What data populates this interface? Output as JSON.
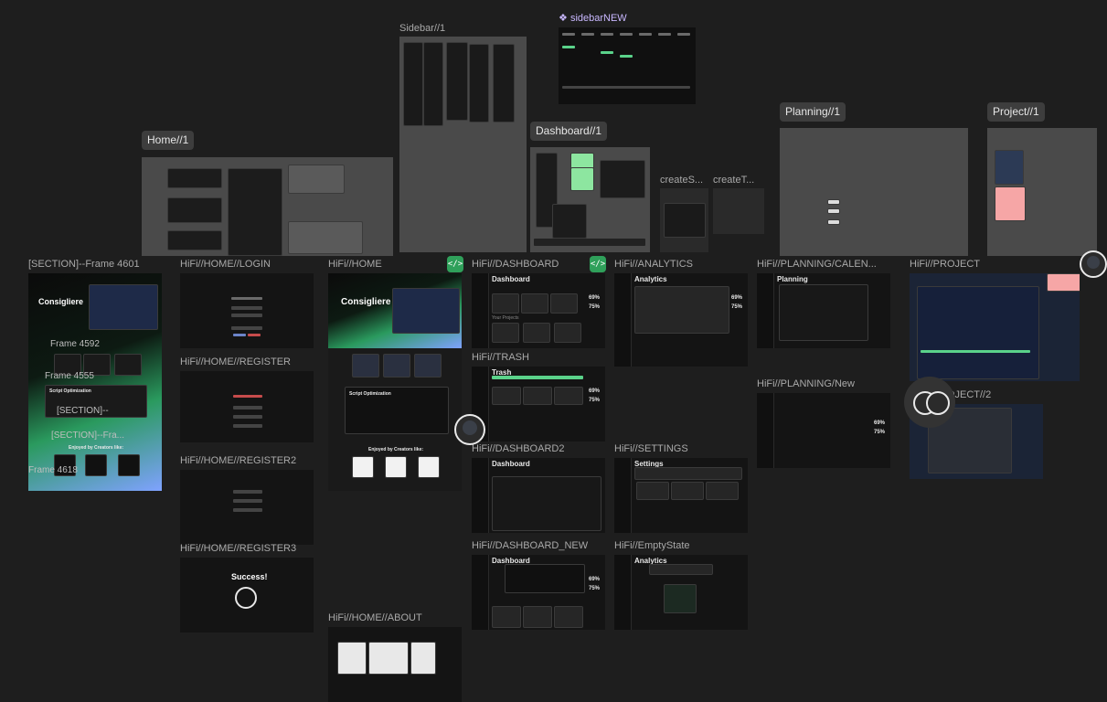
{
  "labels": {
    "sidebar1": "Sidebar//1",
    "sidebarNew": "sidebarNEW",
    "home1": "Home//1",
    "dashboard1": "Dashboard//1",
    "planning1": "Planning//1",
    "project1": "Project//1",
    "createS": "createS...",
    "createT": "createT...",
    "section4601": "[SECTION]--Frame 4601",
    "hifiLogin": "HiFi//HOME//LOGIN",
    "hifiHome": "HiFi//HOME",
    "hifiDashboard": "HiFi//DASHBOARD",
    "hifiAnalytics": "HiFi//ANALYTICS",
    "hifiPlanningCal": "HiFi//PLANNING/CALEN...",
    "hifiProject": "HiFi//PROJECT",
    "hifiRegister": "HiFi//HOME//REGISTER",
    "hifiTrash": "HiFi//TRASH",
    "hifiPlanningNew": "HiFi//PLANNING/New",
    "hifiProject2": "HiFi//PROJECT//2",
    "hifiRegister2": "HiFi//HOME//REGISTER2",
    "hifiDashboard2": "HiFi//DASHBOARD2",
    "hifiSettings": "HiFi//SETTINGS",
    "hifiRegister3": "HiFi//HOME//REGISTER3",
    "hifiDashboardNew": "HiFi//DASHBOARD_NEW",
    "hifiEmptyState": "HiFi//EmptyState",
    "hifiAbout": "HiFi//HOME//ABOUT"
  },
  "overlays": {
    "frame4592": "Frame 4592",
    "frame4555": "Frame 4555",
    "section1": "[SECTION]--",
    "section2": "[SECTION]--Fra...",
    "frame4618": "Frame 4618"
  },
  "content": {
    "consigliere": "Consigliere",
    "consigliere2": "Consigliere",
    "scriptOptimization": "Script Optimization",
    "scriptOptimization2": "Script Optimization",
    "enjoyed": "Enjoyed by Creators like:",
    "enjoyed2": "Enjoyed by Creators like:",
    "success": "Success!",
    "dashboard": "Dashboard",
    "dashboard2": "Dashboard",
    "dashboard3": "Dashboard",
    "trash": "Trash",
    "analytics": "Analytics",
    "analytics2": "Analytics",
    "settings": "Settings",
    "planning": "Planning",
    "yourProjects": "Your Projects",
    "pct69": "69%",
    "pct75": "75%",
    "pct69b": "69%",
    "pct75b": "75%",
    "pct69c": "69%",
    "pct75c": "75%",
    "pct69d": "69%",
    "pct75d": "75%",
    "pct69e": "69%",
    "pct75e": "75%"
  },
  "icons": {
    "embed": "</>",
    "component": "❖"
  },
  "colors": {
    "canvas": "#1e1e1e",
    "accent_green": "#2fa05a",
    "sticky_pink": "#f6a6a6",
    "sticky_yellow": "#ffd84a"
  }
}
